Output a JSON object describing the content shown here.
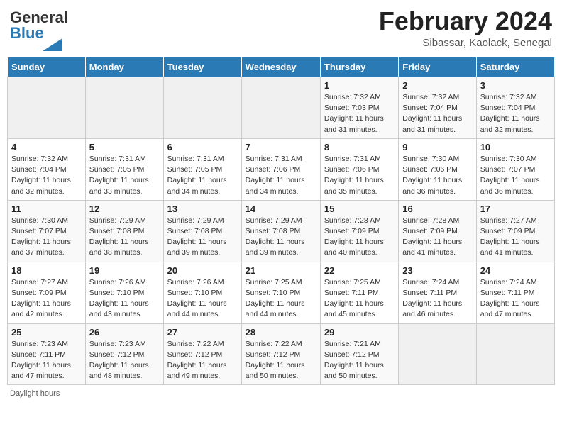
{
  "logo": {
    "general": "General",
    "blue": "Blue"
  },
  "title": "February 2024",
  "location": "Sibassar, Kaolack, Senegal",
  "days_of_week": [
    "Sunday",
    "Monday",
    "Tuesday",
    "Wednesday",
    "Thursday",
    "Friday",
    "Saturday"
  ],
  "weeks": [
    [
      {
        "num": "",
        "info": ""
      },
      {
        "num": "",
        "info": ""
      },
      {
        "num": "",
        "info": ""
      },
      {
        "num": "",
        "info": ""
      },
      {
        "num": "1",
        "info": "Sunrise: 7:32 AM\nSunset: 7:03 PM\nDaylight: 11 hours and 31 minutes."
      },
      {
        "num": "2",
        "info": "Sunrise: 7:32 AM\nSunset: 7:04 PM\nDaylight: 11 hours and 31 minutes."
      },
      {
        "num": "3",
        "info": "Sunrise: 7:32 AM\nSunset: 7:04 PM\nDaylight: 11 hours and 32 minutes."
      }
    ],
    [
      {
        "num": "4",
        "info": "Sunrise: 7:32 AM\nSunset: 7:04 PM\nDaylight: 11 hours and 32 minutes."
      },
      {
        "num": "5",
        "info": "Sunrise: 7:31 AM\nSunset: 7:05 PM\nDaylight: 11 hours and 33 minutes."
      },
      {
        "num": "6",
        "info": "Sunrise: 7:31 AM\nSunset: 7:05 PM\nDaylight: 11 hours and 34 minutes."
      },
      {
        "num": "7",
        "info": "Sunrise: 7:31 AM\nSunset: 7:06 PM\nDaylight: 11 hours and 34 minutes."
      },
      {
        "num": "8",
        "info": "Sunrise: 7:31 AM\nSunset: 7:06 PM\nDaylight: 11 hours and 35 minutes."
      },
      {
        "num": "9",
        "info": "Sunrise: 7:30 AM\nSunset: 7:06 PM\nDaylight: 11 hours and 36 minutes."
      },
      {
        "num": "10",
        "info": "Sunrise: 7:30 AM\nSunset: 7:07 PM\nDaylight: 11 hours and 36 minutes."
      }
    ],
    [
      {
        "num": "11",
        "info": "Sunrise: 7:30 AM\nSunset: 7:07 PM\nDaylight: 11 hours and 37 minutes."
      },
      {
        "num": "12",
        "info": "Sunrise: 7:29 AM\nSunset: 7:08 PM\nDaylight: 11 hours and 38 minutes."
      },
      {
        "num": "13",
        "info": "Sunrise: 7:29 AM\nSunset: 7:08 PM\nDaylight: 11 hours and 39 minutes."
      },
      {
        "num": "14",
        "info": "Sunrise: 7:29 AM\nSunset: 7:08 PM\nDaylight: 11 hours and 39 minutes."
      },
      {
        "num": "15",
        "info": "Sunrise: 7:28 AM\nSunset: 7:09 PM\nDaylight: 11 hours and 40 minutes."
      },
      {
        "num": "16",
        "info": "Sunrise: 7:28 AM\nSunset: 7:09 PM\nDaylight: 11 hours and 41 minutes."
      },
      {
        "num": "17",
        "info": "Sunrise: 7:27 AM\nSunset: 7:09 PM\nDaylight: 11 hours and 41 minutes."
      }
    ],
    [
      {
        "num": "18",
        "info": "Sunrise: 7:27 AM\nSunset: 7:09 PM\nDaylight: 11 hours and 42 minutes."
      },
      {
        "num": "19",
        "info": "Sunrise: 7:26 AM\nSunset: 7:10 PM\nDaylight: 11 hours and 43 minutes."
      },
      {
        "num": "20",
        "info": "Sunrise: 7:26 AM\nSunset: 7:10 PM\nDaylight: 11 hours and 44 minutes."
      },
      {
        "num": "21",
        "info": "Sunrise: 7:25 AM\nSunset: 7:10 PM\nDaylight: 11 hours and 44 minutes."
      },
      {
        "num": "22",
        "info": "Sunrise: 7:25 AM\nSunset: 7:11 PM\nDaylight: 11 hours and 45 minutes."
      },
      {
        "num": "23",
        "info": "Sunrise: 7:24 AM\nSunset: 7:11 PM\nDaylight: 11 hours and 46 minutes."
      },
      {
        "num": "24",
        "info": "Sunrise: 7:24 AM\nSunset: 7:11 PM\nDaylight: 11 hours and 47 minutes."
      }
    ],
    [
      {
        "num": "25",
        "info": "Sunrise: 7:23 AM\nSunset: 7:11 PM\nDaylight: 11 hours and 47 minutes."
      },
      {
        "num": "26",
        "info": "Sunrise: 7:23 AM\nSunset: 7:12 PM\nDaylight: 11 hours and 48 minutes."
      },
      {
        "num": "27",
        "info": "Sunrise: 7:22 AM\nSunset: 7:12 PM\nDaylight: 11 hours and 49 minutes."
      },
      {
        "num": "28",
        "info": "Sunrise: 7:22 AM\nSunset: 7:12 PM\nDaylight: 11 hours and 50 minutes."
      },
      {
        "num": "29",
        "info": "Sunrise: 7:21 AM\nSunset: 7:12 PM\nDaylight: 11 hours and 50 minutes."
      },
      {
        "num": "",
        "info": ""
      },
      {
        "num": "",
        "info": ""
      }
    ]
  ],
  "footer": "Daylight hours"
}
